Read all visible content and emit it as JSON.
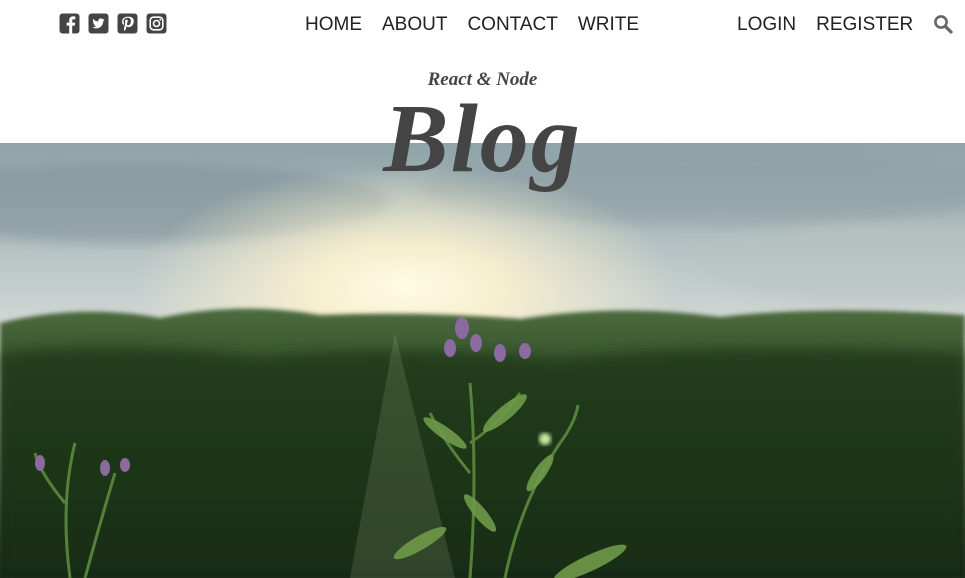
{
  "social": {
    "icons": [
      "facebook-square-icon",
      "twitter-square-icon",
      "pinterest-square-icon",
      "instagram-square-icon"
    ]
  },
  "nav": {
    "center": [
      "HOME",
      "ABOUT",
      "CONTACT",
      "WRITE"
    ],
    "right": [
      "LOGIN",
      "REGISTER"
    ],
    "search_icon": "search-icon"
  },
  "header": {
    "subtitle": "React & Node",
    "title": "Blog"
  },
  "hero": {
    "image": "sunlit meadow with wildflowers"
  },
  "colors": {
    "text_dark": "#222222",
    "icon_gray": "#444444",
    "title_gray": "#444444",
    "background": "#ffffff"
  }
}
